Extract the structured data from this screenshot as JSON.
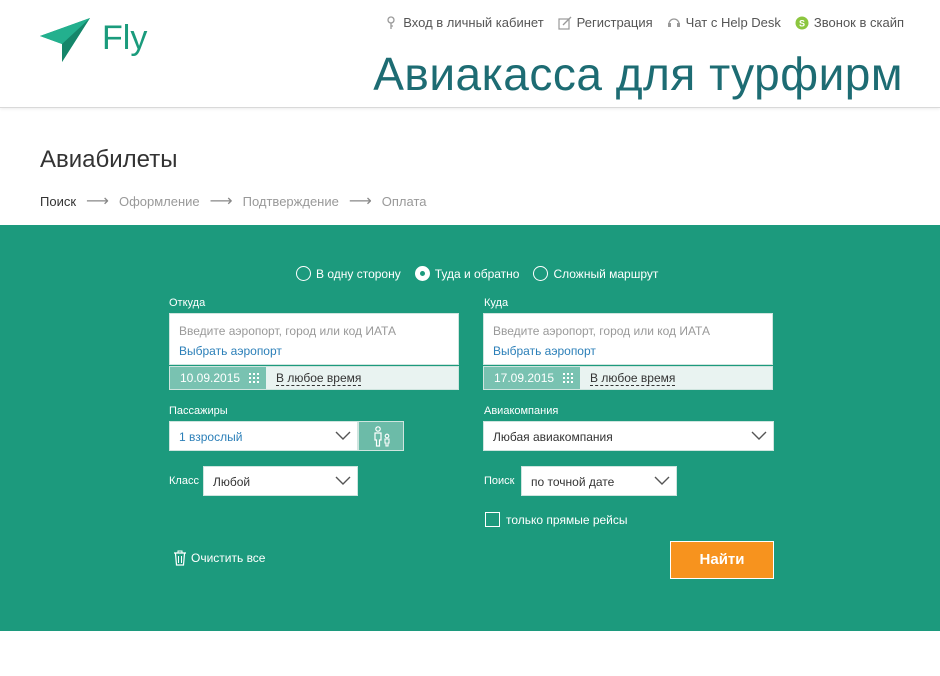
{
  "header": {
    "logo_text": "Fly",
    "tagline": "Авиакасса для турфирм",
    "links": [
      {
        "label": "Вход в личный кабинет",
        "icon": "key-icon"
      },
      {
        "label": "Регистрация",
        "icon": "edit-icon"
      },
      {
        "label": "Чат с Help Desk",
        "icon": "headset-icon"
      },
      {
        "label": "Звонок в скайп",
        "icon": "skype-icon"
      }
    ],
    "colors": {
      "brand": "#1a9b7c",
      "tagline": "#1d6c73"
    }
  },
  "page": {
    "title": "Авиабилеты",
    "steps": [
      "Поиск",
      "Оформление",
      "Подтверждение",
      "Оплата"
    ],
    "active_step": "Поиск"
  },
  "search": {
    "panel_color": "#1c9a7d",
    "trip_types": [
      {
        "label": "В одну сторону",
        "selected": false
      },
      {
        "label": "Туда и обратно",
        "selected": true
      },
      {
        "label": "Сложный маршрут",
        "selected": false
      }
    ],
    "from": {
      "label": "Откуда",
      "placeholder": "Введите аэропорт, город или код ИАТА",
      "link": "Выбрать аэропорт",
      "date": "10.09.2015",
      "time": "В любое время"
    },
    "to": {
      "label": "Куда",
      "placeholder": "Введите аэропорт, город или код ИАТА",
      "link": "Выбрать аэропорт",
      "date": "17.09.2015",
      "time": "В любое время"
    },
    "passengers": {
      "label": "Пассажиры",
      "value": "1 взрослый"
    },
    "airline": {
      "label": "Авиакомпания",
      "value": "Любая авиакомпания"
    },
    "class": {
      "label": "Класс",
      "value": "Любой"
    },
    "search_mode": {
      "label": "Поиск",
      "value": "по точной дате"
    },
    "direct_only": {
      "label": "только прямые рейсы",
      "checked": false
    },
    "clear_all": "Очистить все",
    "submit": {
      "label": "Найти",
      "color": "#f7931e"
    }
  }
}
